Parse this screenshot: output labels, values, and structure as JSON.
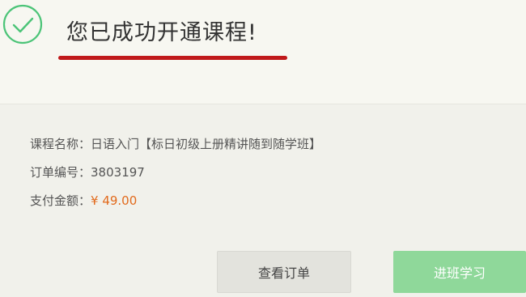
{
  "header": {
    "title": "您已成功开通课程!",
    "accent_color": "#c0191a",
    "success_icon": "check-circle-icon",
    "success_color": "#4cc478"
  },
  "order": {
    "course_label": "课程名称：",
    "course_value": "日语入门【标日初级上册精讲随到随学班】",
    "order_no_label": "订单编号：",
    "order_no_value": "3803197",
    "amount_label": "支付金额：",
    "amount_value": "¥ 49.00",
    "amount_color": "#e26a1c"
  },
  "actions": {
    "view_order_label": "查看订单",
    "enter_class_label": "进班学习",
    "enter_class_color": "#8fd89a"
  }
}
